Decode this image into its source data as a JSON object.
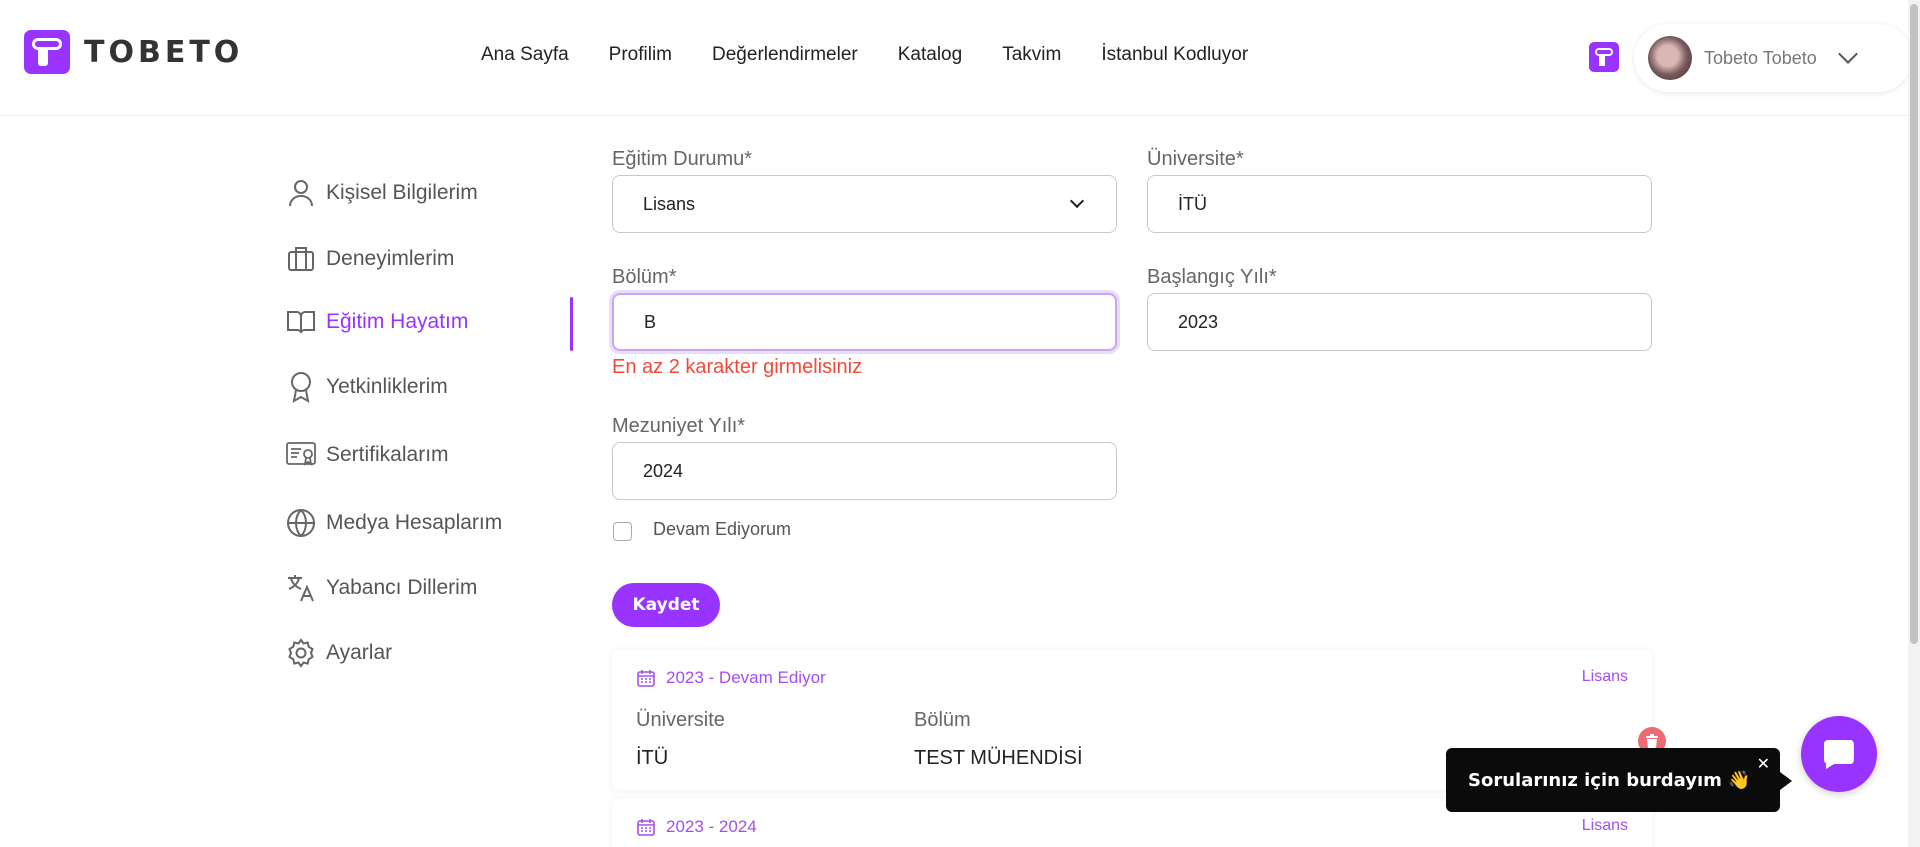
{
  "brand": {
    "name": "TOBETO",
    "accent": "#9933ff"
  },
  "nav": [
    {
      "label": "Ana Sayfa"
    },
    {
      "label": "Profilim"
    },
    {
      "label": "Değerlendirmeler"
    },
    {
      "label": "Katalog"
    },
    {
      "label": "Takvim"
    },
    {
      "label": "İstanbul Kodluyor"
    }
  ],
  "user": {
    "name": "Tobeto Tobeto"
  },
  "sidebar": {
    "items": [
      {
        "label": "Kişisel Bilgilerim",
        "icon": "user-icon"
      },
      {
        "label": "Deneyimlerim",
        "icon": "briefcase-icon"
      },
      {
        "label": "Eğitim Hayatım",
        "icon": "book-icon",
        "active": true
      },
      {
        "label": "Yetkinliklerim",
        "icon": "award-icon"
      },
      {
        "label": "Sertifikalarım",
        "icon": "certificate-icon"
      },
      {
        "label": "Medya Hesaplarım",
        "icon": "globe-icon"
      },
      {
        "label": "Yabancı Dillerim",
        "icon": "translate-icon"
      },
      {
        "label": "Ayarlar",
        "icon": "gear-icon"
      }
    ]
  },
  "form": {
    "education_label": "Eğitim Durumu*",
    "education_value": "Lisans",
    "university_label": "Üniversite*",
    "university_value": "İTÜ",
    "department_label": "Bölüm*",
    "department_value": "B",
    "department_error": "En az 2 karakter girmelisiniz",
    "start_label": "Başlangıç Yılı*",
    "start_value": "2023",
    "grad_label": "Mezuniyet Yılı*",
    "grad_value": "2024",
    "continuing_label": "Devam Ediyorum",
    "continuing_checked": false,
    "save_label": "Kaydet"
  },
  "records": [
    {
      "date": "2023 - Devam Ediyor",
      "type": "Lisans",
      "university_header": "Üniversite",
      "department_header": "Bölüm",
      "university": "İTÜ",
      "department": "TEST MÜHENDİSİ"
    },
    {
      "date": "2023 - 2024",
      "type": "Lisans"
    }
  ],
  "chat": {
    "tooltip": "Sorularınız için burdayım 👋",
    "close": "✕"
  }
}
